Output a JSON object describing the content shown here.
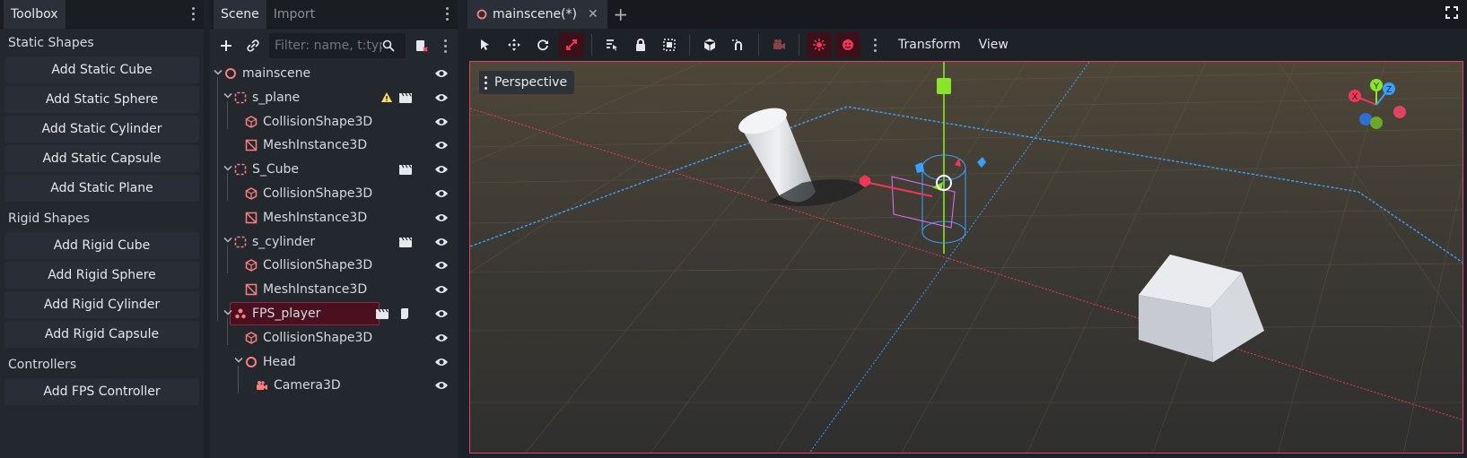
{
  "toolbox": {
    "title": "Toolbox",
    "sections": [
      {
        "title": "Static Shapes",
        "buttons": [
          "Add Static Cube",
          "Add Static Sphere",
          "Add Static Cylinder",
          "Add Static Capsule",
          "Add Static Plane"
        ]
      },
      {
        "title": "Rigid Shapes",
        "buttons": [
          "Add Rigid Cube",
          "Add Rigid Sphere",
          "Add Rigid Cylinder",
          "Add Rigid Capsule"
        ]
      },
      {
        "title": "Controllers",
        "buttons": [
          "Add FPS Controller"
        ]
      }
    ]
  },
  "scene_dock": {
    "tabs": [
      "Scene",
      "Import"
    ],
    "filter_placeholder": "Filter: name, t:typ",
    "tree": [
      {
        "label": "mainscene",
        "icon": "node3d-icon",
        "depth": 0,
        "arrow": "down"
      },
      {
        "label": "s_plane",
        "icon": "static-body-icon",
        "depth": 1,
        "arrow": "down",
        "warning": true,
        "clapper": true
      },
      {
        "label": "CollisionShape3D",
        "icon": "collision-shape-icon",
        "depth": 2
      },
      {
        "label": "MeshInstance3D",
        "icon": "mesh-instance-icon",
        "depth": 2
      },
      {
        "label": "S_Cube",
        "icon": "static-body-icon",
        "depth": 1,
        "arrow": "down",
        "clapper": true
      },
      {
        "label": "CollisionShape3D",
        "icon": "collision-shape-icon",
        "depth": 2
      },
      {
        "label": "MeshInstance3D",
        "icon": "mesh-instance-icon",
        "depth": 2
      },
      {
        "label": "s_cylinder",
        "icon": "static-body-icon",
        "depth": 1,
        "arrow": "down",
        "clapper": true
      },
      {
        "label": "CollisionShape3D",
        "icon": "collision-shape-icon",
        "depth": 2
      },
      {
        "label": "MeshInstance3D",
        "icon": "mesh-instance-icon",
        "depth": 2
      },
      {
        "label": "FPS_player",
        "icon": "character-body-icon",
        "depth": 1,
        "arrow": "down",
        "clapper": true,
        "script": true,
        "selected": true
      },
      {
        "label": "CollisionShape3D",
        "icon": "collision-shape-icon",
        "depth": 2
      },
      {
        "label": "Head",
        "icon": "node3d-icon",
        "depth": 2,
        "arrow": "down"
      },
      {
        "label": "Camera3D",
        "icon": "camera-icon",
        "depth": 3
      }
    ]
  },
  "editor": {
    "tab_label": "mainscene(*)",
    "toolbar_menus": [
      "Transform",
      "View"
    ],
    "viewport_label": "Perspective",
    "gizmo_axes": {
      "x": "X",
      "y": "Y",
      "z": "Z"
    }
  },
  "colors": {
    "accent": "#e0435f",
    "x_axis": "#f1365a",
    "y_axis": "#8ae52a",
    "z_axis": "#2f90f0",
    "node_icon": "#fc7f7f"
  }
}
